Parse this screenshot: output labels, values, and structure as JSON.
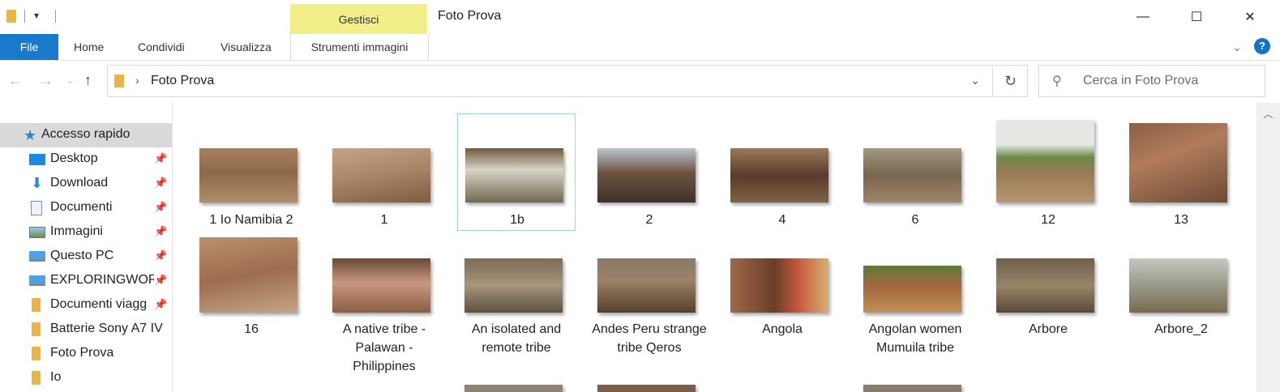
{
  "window": {
    "title": "Foto Prova",
    "context_tab": "Gestisci",
    "minimize": "—",
    "maximize": "☐",
    "close": "✕"
  },
  "ribbon": {
    "tabs": [
      "File",
      "Home",
      "Condividi",
      "Visualizza",
      "Strumenti immagini"
    ],
    "active_color": "#1979ca",
    "context_color": "#f2ee8a"
  },
  "address": {
    "path": "Foto Prova",
    "separator": "›",
    "search_placeholder": "Cerca in Foto Prova"
  },
  "sidebar": {
    "items": [
      {
        "label": "Accesso rapido",
        "icon": "star-icon",
        "pinned": false
      },
      {
        "label": "Desktop",
        "icon": "desktop-icon",
        "pinned": true
      },
      {
        "label": "Download",
        "icon": "download-icon",
        "pinned": true
      },
      {
        "label": "Documenti",
        "icon": "document-icon",
        "pinned": true
      },
      {
        "label": "Immagini",
        "icon": "pictures-icon",
        "pinned": true
      },
      {
        "label": "Questo PC",
        "icon": "computer-icon",
        "pinned": true
      },
      {
        "label": "EXPLORINGWOR",
        "icon": "computer-icon",
        "pinned": true
      },
      {
        "label": "Documenti viagg",
        "icon": "folder-icon",
        "pinned": true
      },
      {
        "label": "Batterie Sony A7 IV",
        "icon": "folder-icon",
        "pinned": false
      },
      {
        "label": "Foto Prova",
        "icon": "folder-icon",
        "pinned": false
      },
      {
        "label": "Io",
        "icon": "folder-icon",
        "pinned": false
      }
    ]
  },
  "files": [
    {
      "name": "1 Io Namibia 2",
      "selected": false
    },
    {
      "name": "1",
      "selected": false
    },
    {
      "name": "1b",
      "selected": true
    },
    {
      "name": "2",
      "selected": false
    },
    {
      "name": "4",
      "selected": false
    },
    {
      "name": "6",
      "selected": false
    },
    {
      "name": "12",
      "selected": false
    },
    {
      "name": "13",
      "selected": false
    },
    {
      "name": "16",
      "selected": false
    },
    {
      "name": "A native tribe - Palawan - Philippines",
      "selected": false
    },
    {
      "name": "An isolated and remote tribe",
      "selected": false
    },
    {
      "name": "Andes Peru strange tribe Qeros",
      "selected": false
    },
    {
      "name": "Angola",
      "selected": false
    },
    {
      "name": "Angolan women Mumuila tribe",
      "selected": false
    },
    {
      "name": "Arbore",
      "selected": false
    },
    {
      "name": "Arbore_2",
      "selected": false
    }
  ]
}
